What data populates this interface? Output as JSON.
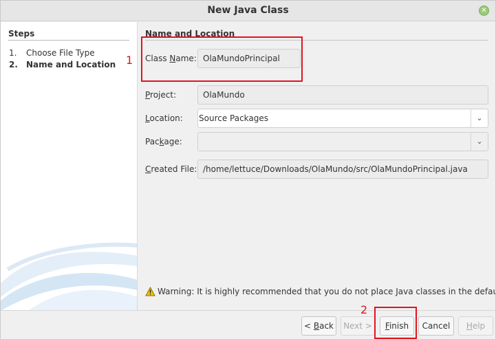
{
  "window": {
    "title": "New Java Class",
    "close_glyph": "✕"
  },
  "steps": {
    "title": "Steps",
    "items": [
      {
        "num": "1.",
        "label": "Choose File Type",
        "current": false
      },
      {
        "num": "2.",
        "label": "Name and Location",
        "current": true
      }
    ]
  },
  "form": {
    "section_title": "Name and Location",
    "class_name": {
      "label_pre": "Class ",
      "label_key": "N",
      "label_post": "ame:",
      "value": "OlaMundoPrincipal"
    },
    "project": {
      "label_pre": "",
      "label_key": "P",
      "label_post": "roject:",
      "value": "OlaMundo"
    },
    "location": {
      "label_pre": "",
      "label_key": "L",
      "label_post": "ocation:",
      "value": "Source Packages"
    },
    "package": {
      "label_pre": "Pac",
      "label_key": "k",
      "label_post": "age:",
      "value": ""
    },
    "created_file": {
      "label_pre": "",
      "label_key": "C",
      "label_post": "reated File:",
      "value": "/home/lettuce/Downloads/OlaMundo/src/OlaMundoPrincipal.java"
    }
  },
  "warning": {
    "icon": "warning-icon",
    "text": "Warning: It is highly recommended that you do not place Java classes in the default pac"
  },
  "buttons": {
    "back": {
      "pre": "< ",
      "key": "B",
      "post": "ack",
      "enabled": true
    },
    "next": {
      "text": "Next >",
      "enabled": false
    },
    "finish": {
      "pre": "",
      "key": "F",
      "post": "inish",
      "enabled": true
    },
    "cancel": {
      "text": "Cancel",
      "enabled": true
    },
    "help": {
      "pre": "",
      "key": "H",
      "post": "elp",
      "enabled": false
    }
  },
  "annotations": {
    "one": "1",
    "two": "2",
    "color": "#e0141d"
  },
  "colors": {
    "window_bg": "#f0f0f0",
    "field_bg": "#ececec",
    "highlight": "#e0141d"
  }
}
